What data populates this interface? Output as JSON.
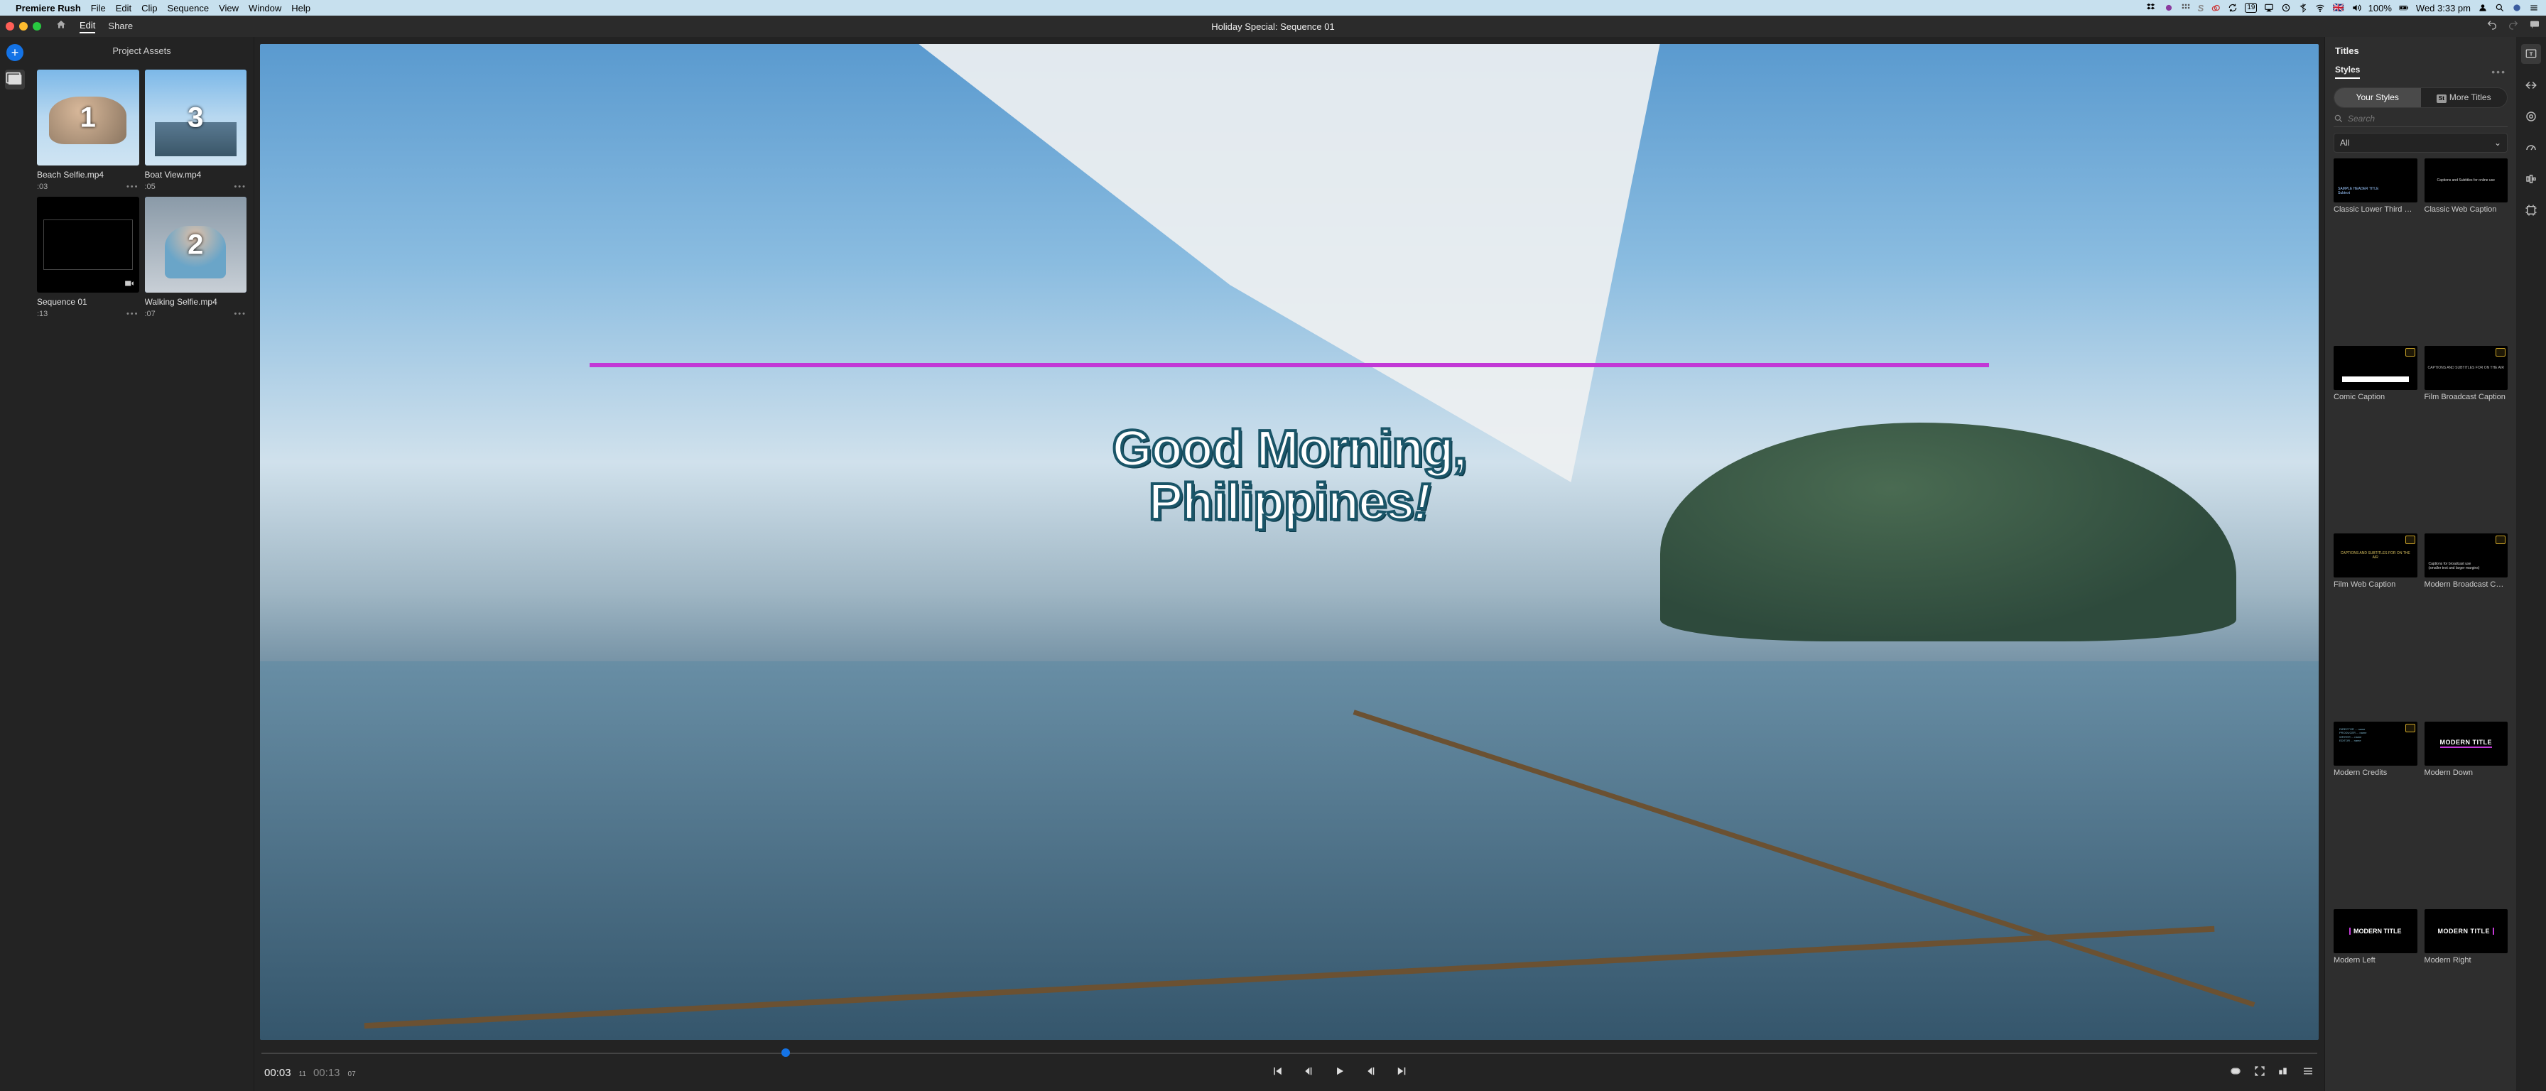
{
  "mac_menu": {
    "app_name": "Premiere Rush",
    "items": [
      "File",
      "Edit",
      "Clip",
      "Sequence",
      "View",
      "Window",
      "Help"
    ],
    "battery": "100%",
    "flag": "🇬🇧",
    "time": "Wed 3:33 pm",
    "cal_day": "19"
  },
  "toolbar": {
    "edit_tab": "Edit",
    "share_tab": "Share",
    "document_title": "Holiday Special: Sequence 01"
  },
  "project_panel": {
    "title": "Project Assets"
  },
  "assets": [
    {
      "name": "Beach Selfie.mp4",
      "dur": ":03",
      "index": "1",
      "kind": "video"
    },
    {
      "name": "Boat View.mp4",
      "dur": ":05",
      "index": "3",
      "kind": "video",
      "selected": true
    },
    {
      "name": "Sequence 01",
      "dur": ":13",
      "index": "",
      "kind": "sequence"
    },
    {
      "name": "Walking Selfie.mp4",
      "dur": ":07",
      "index": "2",
      "kind": "video",
      "selected": true
    }
  ],
  "preview": {
    "title_line1": "Good Morning,",
    "title_line2": "Philippines",
    "title_em": "!",
    "playhead_pct": 25.5,
    "tc_current": "00:03",
    "tc_current_frames": "11",
    "tc_duration": "00:13",
    "tc_duration_frames": "07"
  },
  "titles_panel": {
    "header": "Titles",
    "section": "Styles",
    "tab_your": "Your Styles",
    "tab_more": "More Titles",
    "search_placeholder": "Search",
    "filter_value": "All"
  },
  "presets": [
    {
      "name": "Classic Lower Third …",
      "style": "blue-lower"
    },
    {
      "name": "Classic Web Caption",
      "style": "web-caption"
    },
    {
      "name": "Comic Caption",
      "style": "comic",
      "badge": true
    },
    {
      "name": "Film Broadcast Caption",
      "style": "film-bc",
      "badge": true
    },
    {
      "name": "Film Web Caption",
      "style": "yellow-cap",
      "badge": true
    },
    {
      "name": "Modern Broadcast C…",
      "style": "modern-bc",
      "badge": true
    },
    {
      "name": "Modern Credits",
      "style": "credits",
      "badge": true
    },
    {
      "name": "Modern Down",
      "style": "modern-down"
    },
    {
      "name": "Modern Left",
      "style": "modern-left"
    },
    {
      "name": "Modern Right",
      "style": "modern-right"
    }
  ]
}
